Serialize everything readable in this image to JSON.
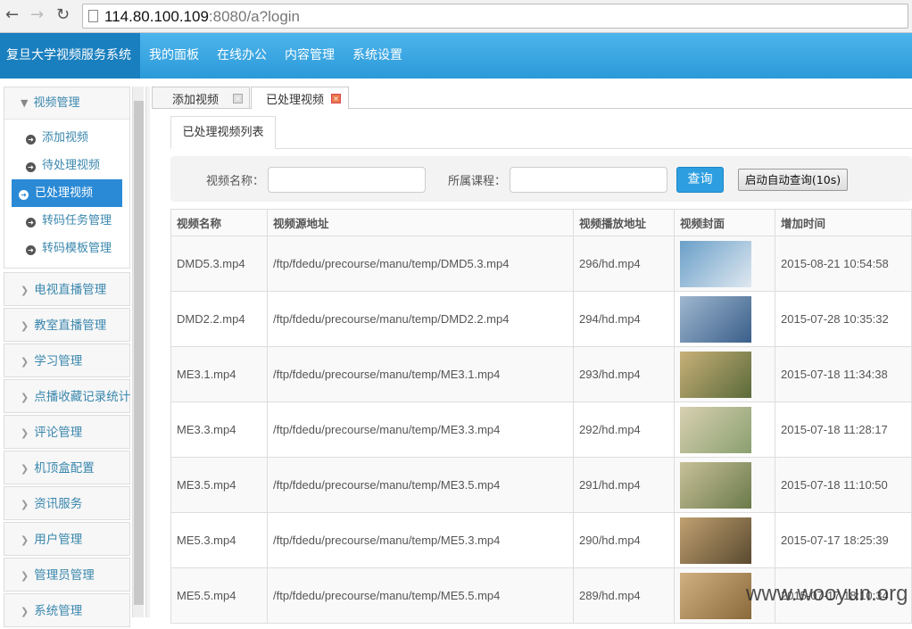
{
  "browser": {
    "url_host": "114.80.100.109",
    "url_rest": ":8080/a?login"
  },
  "topnav": {
    "brand": "复旦大学视频服务系统",
    "menu": [
      "我的面板",
      "在线办公",
      "内容管理",
      "系统设置"
    ]
  },
  "sidebar": {
    "open_group": "视频管理",
    "items": [
      "添加视频",
      "待处理视频",
      "已处理视频",
      "转码任务管理",
      "转码模板管理"
    ],
    "active_item": "已处理视频",
    "groups": [
      "电视直播管理",
      "教室直播管理",
      "学习管理",
      "点播收藏记录统计",
      "评论管理",
      "机顶盒配置",
      "资讯服务",
      "用户管理",
      "管理员管理",
      "系统管理"
    ]
  },
  "tabs": [
    {
      "label": "添加视频",
      "active": false
    },
    {
      "label": "已处理视频",
      "active": true
    }
  ],
  "subtab": "已处理视频列表",
  "search": {
    "name_label": "视频名称：",
    "name_value": "",
    "course_label": "所属课程：",
    "course_value": "",
    "query_button": "查询",
    "auto_button": "启动自动查询(10s)"
  },
  "table": {
    "headers": [
      "视频名称",
      "视频源地址",
      "视频播放地址",
      "视频封面",
      "增加时间"
    ],
    "rows": [
      [
        "DMD5.3.mp4",
        "/ftp/fdedu/precourse/manu/temp/DMD5.3.mp4",
        "296/hd.mp4",
        "2015-08-21 10:54:58"
      ],
      [
        "DMD2.2.mp4",
        "/ftp/fdedu/precourse/manu/temp/DMD2.2.mp4",
        "294/hd.mp4",
        "2015-07-28 10:35:32"
      ],
      [
        "ME3.1.mp4",
        "/ftp/fdedu/precourse/manu/temp/ME3.1.mp4",
        "293/hd.mp4",
        "2015-07-18 11:34:38"
      ],
      [
        "ME3.3.mp4",
        "/ftp/fdedu/precourse/manu/temp/ME3.3.mp4",
        "292/hd.mp4",
        "2015-07-18 11:28:17"
      ],
      [
        "ME3.5.mp4",
        "/ftp/fdedu/precourse/manu/temp/ME3.5.mp4",
        "291/hd.mp4",
        "2015-07-18 11:10:50"
      ],
      [
        "ME5.3.mp4",
        "/ftp/fdedu/precourse/manu/temp/ME5.3.mp4",
        "290/hd.mp4",
        "2015-07-17 18:25:39"
      ],
      [
        "ME5.5.mp4",
        "/ftp/fdedu/precourse/manu/temp/ME5.5.mp4",
        "289/hd.mp4",
        "2015-07-17 18:10:34"
      ]
    ]
  },
  "watermark": "www.wooyun.org"
}
